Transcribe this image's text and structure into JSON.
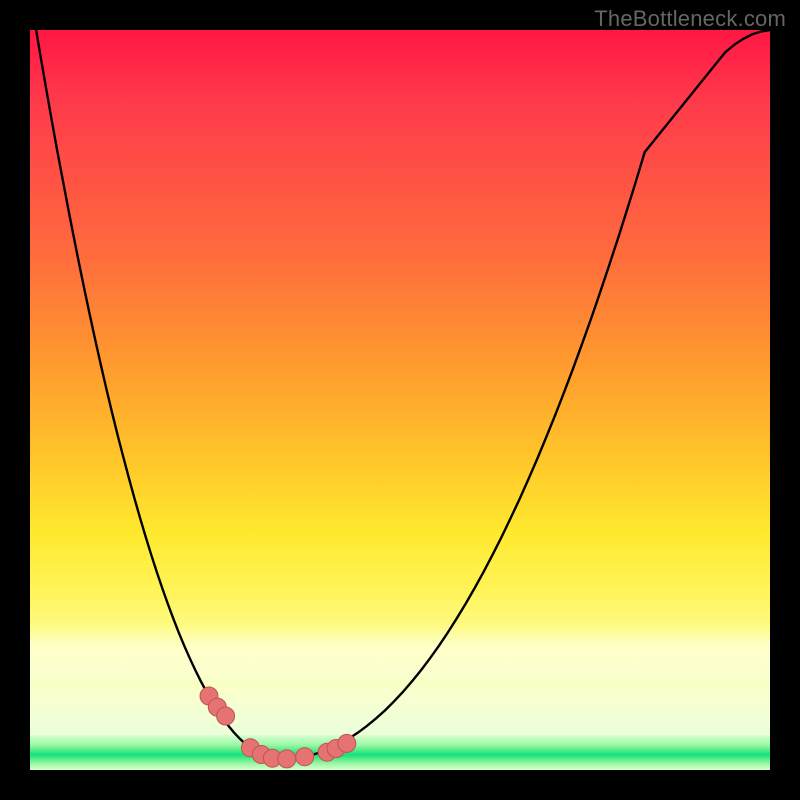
{
  "watermark": "TheBottleneck.com",
  "colors": {
    "curve_stroke": "#000000",
    "marker_fill": "#e57373",
    "marker_stroke": "#c1544f",
    "gradient_top": "#ff1744",
    "gradient_mid": "#ffe92e",
    "gradient_bottom": "#11e08d"
  },
  "chart_data": {
    "type": "line",
    "title": "",
    "xlabel": "",
    "ylabel": "",
    "xlim": [
      0,
      100
    ],
    "ylim": [
      0,
      100
    ],
    "x": [
      0,
      1,
      2,
      3,
      4,
      5,
      6,
      7,
      8,
      9,
      10,
      11,
      12,
      13,
      14,
      15,
      16,
      17,
      18,
      19,
      20,
      21,
      22,
      23,
      24,
      25,
      26,
      27,
      28,
      29,
      30,
      31,
      32,
      33,
      34,
      35,
      36,
      37,
      38,
      39,
      40,
      41,
      42,
      43,
      44,
      45,
      46,
      47,
      48,
      49,
      50,
      51,
      52,
      53,
      54,
      55,
      56,
      57,
      58,
      59,
      60,
      61,
      62,
      63,
      64,
      65,
      66,
      67,
      68,
      69,
      70,
      71,
      72,
      73,
      74,
      75,
      76,
      77,
      78,
      79,
      80,
      81,
      82,
      83,
      84,
      85,
      86,
      87,
      88,
      89,
      90,
      91,
      92,
      93,
      94,
      95,
      96,
      97,
      98,
      99,
      100
    ],
    "y": [
      105,
      100.5,
      96.1,
      91.8,
      87.6,
      83.5,
      79.5,
      75.6,
      71.8,
      68.1,
      64.5,
      61.0,
      57.6,
      54.3,
      51.1,
      48.0,
      45.0,
      42.1,
      39.3,
      36.6,
      34.0,
      31.5,
      29.1,
      26.8,
      24.6,
      22.5,
      20.5,
      18.6,
      16.8,
      15.1,
      13.5,
      12.0,
      10.6,
      9.3,
      8.1,
      7.0,
      6.0,
      5.1,
      4.3,
      3.6,
      3.0,
      2.5,
      2.1,
      1.8,
      1.6,
      1.5,
      1.5,
      1.6,
      1.8,
      2.1,
      2.5,
      3.0,
      3.6,
      4.3,
      5.1,
      6.0,
      7.0,
      8.1,
      9.3,
      10.6,
      12.0,
      13.5,
      15.1,
      16.8,
      18.6,
      20.5,
      22.5,
      24.6,
      26.8,
      29.1,
      31.5,
      34.0,
      36.6,
      39.3,
      42.1,
      45.0,
      48.0,
      51.1,
      54.3,
      57.6,
      61.0,
      64.5,
      68.1,
      71.8,
      75.6,
      79.5,
      83.5,
      85.0,
      86.5,
      88.0,
      89.5,
      91.0,
      92.5,
      94.0,
      95.5,
      97.0,
      98.0,
      98.8,
      99.4,
      99.8,
      100.0
    ],
    "markers": {
      "x": [
        32.5,
        34,
        35.5,
        40,
        42,
        44,
        46,
        48,
        50.5,
        51.5,
        52.7
      ],
      "y": [
        10.0,
        8.5,
        7.3,
        3.0,
        2.1,
        1.6,
        1.5,
        1.8,
        2.4,
        2.9,
        3.6
      ]
    },
    "note": "V-shaped bottleneck curve on rainbow gradient; axes unlabeled; values are percentages estimated from pixel positions."
  }
}
